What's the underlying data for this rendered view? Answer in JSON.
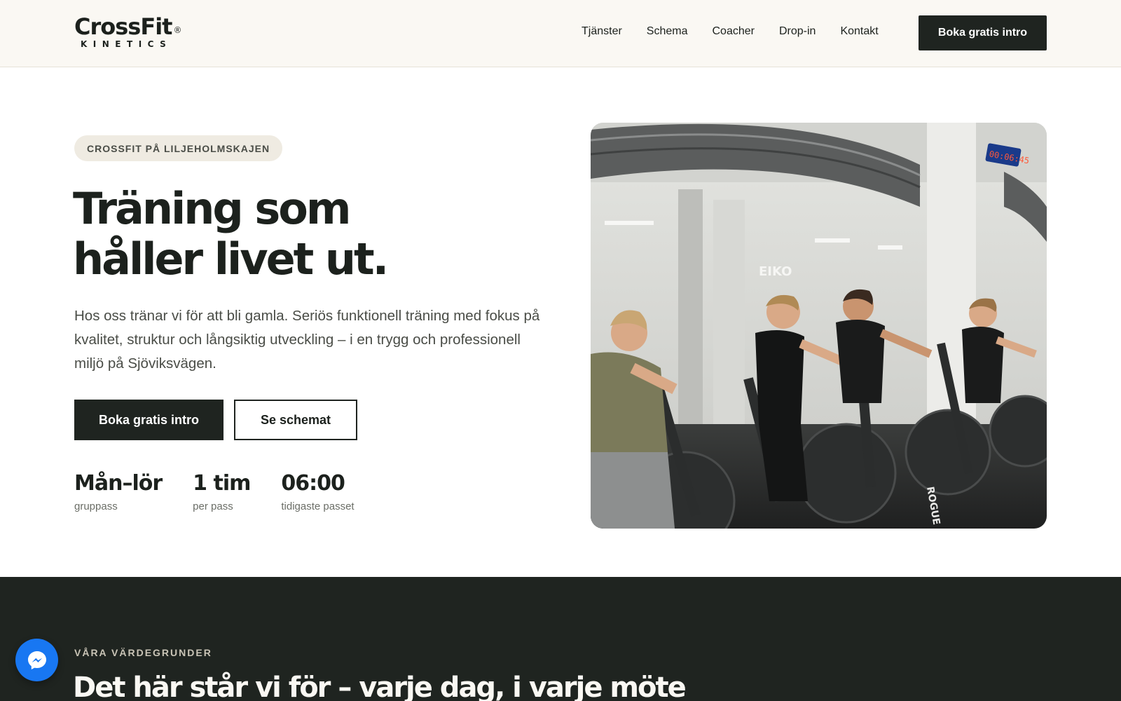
{
  "header": {
    "logo_main": "CrossFit",
    "logo_reg": "®",
    "logo_sub": "KINETICS",
    "nav": [
      {
        "label": "Tjänster"
      },
      {
        "label": "Schema"
      },
      {
        "label": "Coacher"
      },
      {
        "label": "Drop-in"
      },
      {
        "label": "Kontakt"
      }
    ],
    "cta_label": "Boka gratis intro"
  },
  "hero": {
    "eyebrow": "CROSSFIT PÅ LILJEHOLMSKAJEN",
    "title_line1": "Träning som",
    "title_line2": "håller livet ut.",
    "text": "Hos oss tränar vi för att bli gamla. Seriös funktionell träning med fokus på kvalitet, struktur och långsiktig utveckling – i en trygg och professionell miljö på Sjöviksvägen.",
    "primary_button": "Boka gratis intro",
    "secondary_button": "Se schemat",
    "stats": [
      {
        "value": "Mån–lör",
        "label": "gruppass"
      },
      {
        "value": "1 tim",
        "label": "per pass"
      },
      {
        "value": "06:00",
        "label": "tidigaste passet"
      }
    ],
    "photo": {
      "wall_text": "EIKO",
      "clock_text": "00:06:45",
      "bike_brand": "ROGUE"
    }
  },
  "values": {
    "eyebrow": "VÅRA VÄRDEGRUNDER",
    "title": "Det här står vi för – varje dag, i varje möte"
  },
  "colors": {
    "header_bg": "#faf8f3",
    "dark": "#1f2420",
    "eyebrow_bg": "#efebe2",
    "messenger": "#1877f2"
  },
  "icons": {
    "messenger": "messenger-icon"
  }
}
